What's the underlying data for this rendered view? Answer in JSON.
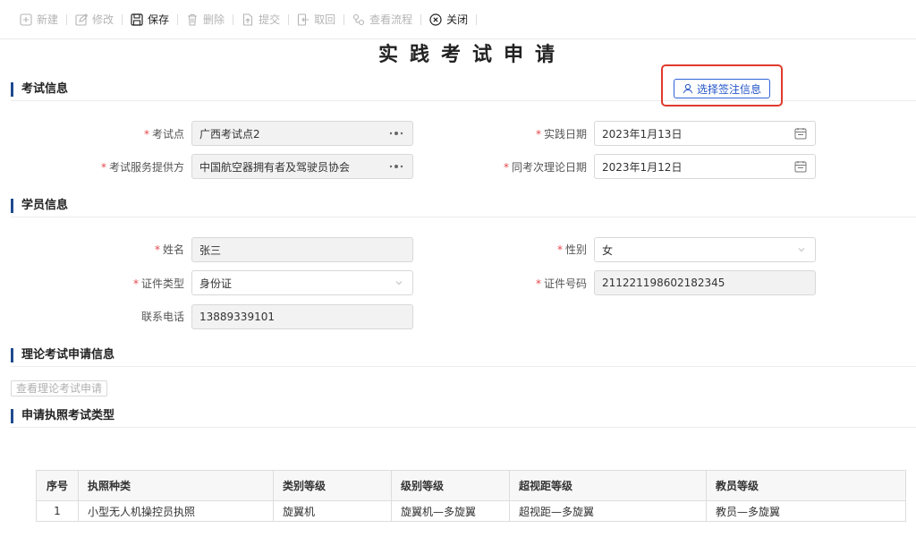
{
  "toolbar": {
    "buttons": [
      {
        "label": "新建",
        "icon": "plus-square-icon",
        "enabled": false
      },
      {
        "label": "修改",
        "icon": "edit-icon",
        "enabled": false
      },
      {
        "label": "保存",
        "icon": "save-icon",
        "enabled": true
      },
      {
        "label": "删除",
        "icon": "trash-icon",
        "enabled": false
      },
      {
        "label": "提交",
        "icon": "submit-icon",
        "enabled": false
      },
      {
        "label": "取回",
        "icon": "retrieve-icon",
        "enabled": false
      },
      {
        "label": "查看流程",
        "icon": "flow-icon",
        "enabled": false
      },
      {
        "label": "关闭",
        "icon": "close-circle-icon",
        "enabled": true
      }
    ]
  },
  "page_title": "实践考试申请",
  "sign_button": {
    "label": "选择签注信息",
    "icon": "user-icon"
  },
  "sections": {
    "exam_info": "考试信息",
    "student_info": "学员信息",
    "theory_info": "理论考试申请信息",
    "license_type": "申请执照考试类型"
  },
  "exam_info": {
    "exam_site": {
      "label": "考试点",
      "required": true,
      "value": "广西考试点2",
      "icon": "more-dots-icon"
    },
    "practice_date": {
      "label": "实践日期",
      "required": true,
      "value": "2023年1月13日",
      "icon": "calendar-icon"
    },
    "provider": {
      "label": "考试服务提供方",
      "required": true,
      "value": "中国航空器拥有者及驾驶员协会",
      "icon": "more-dots-icon"
    },
    "theory_date": {
      "label": "同考次理论日期",
      "required": true,
      "value": "2023年1月12日",
      "icon": "calendar-icon"
    }
  },
  "student_info": {
    "name": {
      "label": "姓名",
      "required": true,
      "value": "张三"
    },
    "gender": {
      "label": "性别",
      "required": true,
      "value": "女",
      "icon": "chevron-down-icon"
    },
    "id_type": {
      "label": "证件类型",
      "required": true,
      "value": "身份证",
      "icon": "chevron-down-icon"
    },
    "id_number": {
      "label": "证件号码",
      "required": true,
      "value": "211221198602182345"
    },
    "phone": {
      "label": "联系电话",
      "required": false,
      "value": "13889339101"
    }
  },
  "theory_button": "查看理论考试申请",
  "table": {
    "columns": [
      "序号",
      "执照种类",
      "类别等级",
      "级别等级",
      "超视距等级",
      "教员等级"
    ],
    "rows": [
      [
        "1",
        "小型无人机操控员执照",
        "旋翼机",
        "旋翼机—多旋翼",
        "超视距—多旋翼",
        "教员—多旋翼"
      ]
    ]
  },
  "colors": {
    "accent": "#1f4a8f",
    "required_mark": "#e5484d",
    "highlight_border": "#e03a2e",
    "link_blue": "#2456c9"
  }
}
